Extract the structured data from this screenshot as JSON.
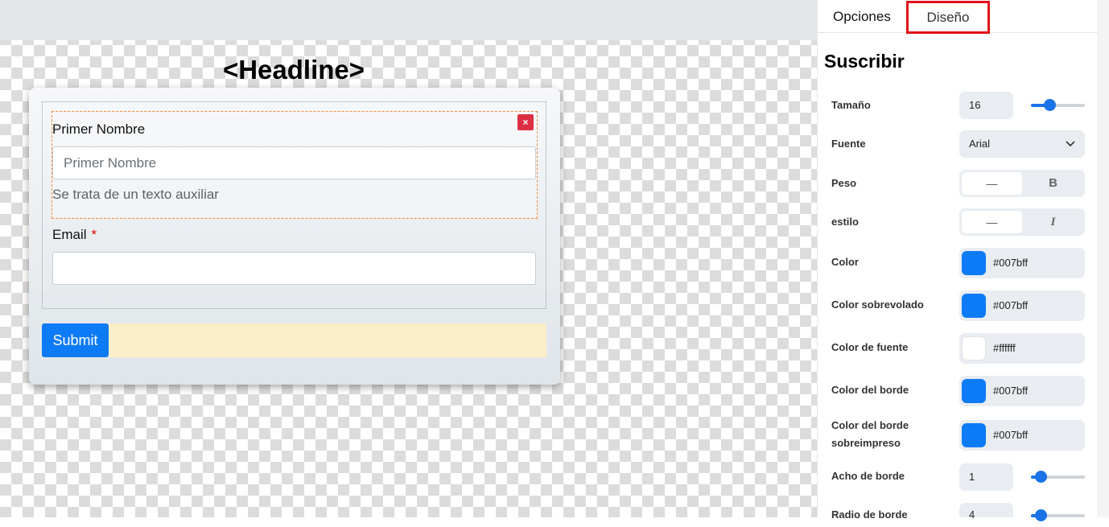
{
  "canvas": {
    "headline": "<Headline>",
    "form": {
      "field1": {
        "label": "Primer Nombre",
        "placeholder": "Primer Nombre",
        "help": "Se trata de un texto auxiliar",
        "close_icon": "×"
      },
      "field2": {
        "label": "Email",
        "required_mark": "*",
        "value": ""
      },
      "submit_label": "Submit"
    }
  },
  "panel": {
    "tabs": [
      {
        "label": "Opciones",
        "active": false
      },
      {
        "label": "Diseño",
        "active": true
      }
    ],
    "section_title": "Suscribir",
    "props": {
      "size": {
        "label": "Tamaño",
        "value": "16",
        "slider_fraction": 0.35
      },
      "font": {
        "label": "Fuente",
        "value": "Arial",
        "icon": "chevron-down-icon"
      },
      "weight": {
        "label": "Peso",
        "option_a": "—",
        "option_b": "B"
      },
      "style": {
        "label": "estilo",
        "option_a": "—",
        "option_b": "I"
      },
      "color": {
        "label": "Color",
        "value": "#007bff",
        "swatch": "#0d7bf5"
      },
      "hover_color": {
        "label": "Color sobrevolado",
        "value": "#007bff",
        "swatch": "#0d7bf5"
      },
      "font_color": {
        "label": "Color de fuente",
        "value": "#ffffff",
        "swatch": "#ffffff"
      },
      "border_color": {
        "label": "Color del borde",
        "value": "#007bff",
        "swatch": "#0d7bf5"
      },
      "border_hover_color": {
        "label_line1": "Color del borde",
        "label_line2": "sobreimpreso",
        "value": "#007bff",
        "swatch": "#0d7bf5"
      },
      "border_width": {
        "label": "Acho de borde",
        "value": "1",
        "slider_fraction": 0.18
      },
      "border_radius": {
        "label": "Radio de borde",
        "value": "4",
        "slider_fraction": 0.18
      }
    }
  },
  "colors": {
    "accent": "#0d7bf5",
    "tab_highlight": "#e0101c",
    "selected_field_border": "#f08a3c",
    "close_button": "#dc2f45"
  }
}
